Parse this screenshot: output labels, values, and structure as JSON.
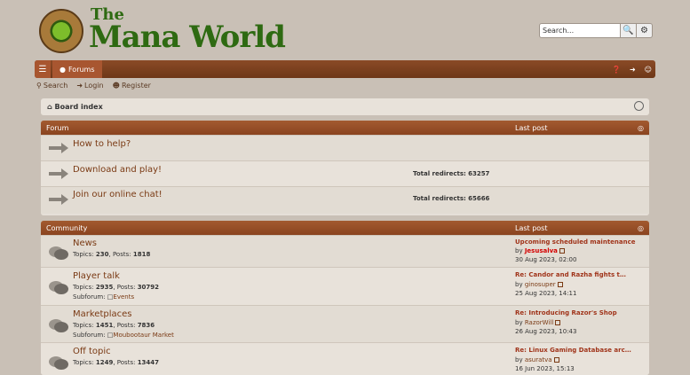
{
  "logo": {
    "the": "The",
    "name": "Mana World"
  },
  "search": {
    "placeholder": "Search…",
    "value": "Search..."
  },
  "navbar": {
    "forums_label": "Forums"
  },
  "sublinks": {
    "search": "Search",
    "login": "Login",
    "register": "Register"
  },
  "breadcrumb": {
    "board_index": "Board index"
  },
  "forum_section": {
    "title": "Forum",
    "last_post_header": "Last post",
    "rows": [
      {
        "title": "How to help?",
        "redirects": ""
      },
      {
        "title": "Download and play!",
        "redirects_label": "Total redirects:",
        "redirects": "63257"
      },
      {
        "title": "Join our online chat!",
        "redirects_label": "Total redirects:",
        "redirects": "65666"
      }
    ]
  },
  "community_section": {
    "title": "Community",
    "last_post_header": "Last post",
    "rows": [
      {
        "title": "News",
        "topics_label": "Topics:",
        "topics": "230",
        "posts_label": "Posts:",
        "posts": "1818",
        "last_post": {
          "title": "Upcoming scheduled maintenance",
          "by": "by",
          "author": "Jesusalva",
          "date": "30 Aug 2023, 02:00"
        }
      },
      {
        "title": "Player talk",
        "topics_label": "Topics:",
        "topics": "2935",
        "posts_label": "Posts:",
        "posts": "30792",
        "subforums_label": "Subforum:",
        "subforum": "Events",
        "last_post": {
          "title": "Re: Candor and Razha fights t…",
          "by": "by",
          "author": "ginosuper",
          "date": "25 Aug 2023, 14:11"
        }
      },
      {
        "title": "Marketplaces",
        "topics_label": "Topics:",
        "topics": "1451",
        "posts_label": "Posts:",
        "posts": "7836",
        "subforums_label": "Subforum:",
        "subforum": "Moubootaur Market",
        "last_post": {
          "title": "Re: Introducing Razor's Shop",
          "by": "by",
          "author": "RazorWill",
          "date": "26 Aug 2023, 10:43"
        }
      },
      {
        "title": "Off topic",
        "topics_label": "Topics:",
        "topics": "1249",
        "posts_label": "Posts:",
        "posts": "13447",
        "last_post": {
          "title": "Re: Linux Gaming Database arc…",
          "by": "by",
          "author": "asuratva",
          "date": "16 Jun 2023, 15:13"
        }
      }
    ]
  }
}
